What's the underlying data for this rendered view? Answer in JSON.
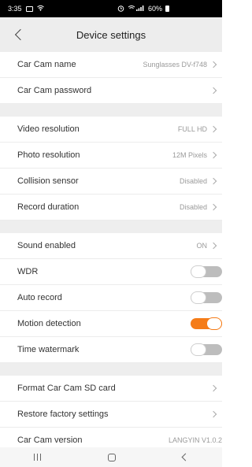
{
  "status_bar": {
    "time": "3:35",
    "battery": "60%"
  },
  "header": {
    "title": "Device settings"
  },
  "groups": [
    {
      "rows": [
        {
          "id": "car-cam-name",
          "label": "Car Cam name",
          "value": "Sunglasses DV-f748",
          "chevron": true
        },
        {
          "id": "car-cam-password",
          "label": "Car Cam password",
          "value": "",
          "chevron": true
        }
      ]
    },
    {
      "rows": [
        {
          "id": "video-resolution",
          "label": "Video resolution",
          "value": "FULL HD",
          "chevron": true
        },
        {
          "id": "photo-resolution",
          "label": "Photo resolution",
          "value": "12M Pixels",
          "chevron": true
        },
        {
          "id": "collision-sensor",
          "label": "Collision sensor",
          "value": "Disabled",
          "chevron": true
        },
        {
          "id": "record-duration",
          "label": "Record duration",
          "value": "Disabled",
          "chevron": true
        }
      ]
    },
    {
      "rows": [
        {
          "id": "sound-enabled",
          "label": "Sound enabled",
          "value": "ON",
          "chevron": true
        },
        {
          "id": "wdr",
          "label": "WDR",
          "toggle": false
        },
        {
          "id": "auto-record",
          "label": "Auto record",
          "toggle": false
        },
        {
          "id": "motion-detection",
          "label": "Motion detection",
          "toggle": true
        },
        {
          "id": "time-watermark",
          "label": "Time watermark",
          "toggle": false
        }
      ]
    },
    {
      "rows": [
        {
          "id": "format-sd-card",
          "label": "Format Car Cam SD card",
          "value": "",
          "chevron": true
        },
        {
          "id": "restore-factory",
          "label": "Restore factory settings",
          "value": "",
          "chevron": true
        },
        {
          "id": "car-cam-version",
          "label": "Car Cam version",
          "value": "LANGYIN V1.0.2",
          "chevron": false
        }
      ]
    }
  ],
  "colors": {
    "accent": "#f57c18",
    "toggle_off": "#bdbdbd",
    "header_bg": "#ededed",
    "separator_bg": "#eeeeee"
  }
}
